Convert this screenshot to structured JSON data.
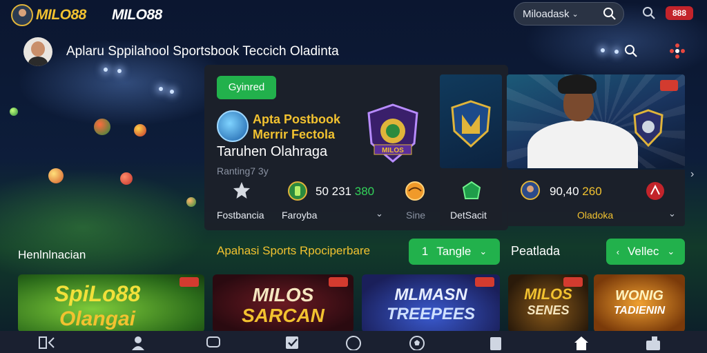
{
  "brand": {
    "logo_text": "MILO88",
    "logo_text_alt": "MILO88"
  },
  "top": {
    "user_label": "Miloadask",
    "badge_text": "888"
  },
  "header": {
    "headline": "Aplaru Sppilahool Sportsbook Teccich Oladinta"
  },
  "promo": {
    "badge": "Gyinred",
    "title_line1": "Apta Postbook",
    "title_line2": "Merrir Fectola",
    "subtitle": "Taruhen Olahraga",
    "ranking": "Ranting7 3y",
    "shield_text": "MILOS"
  },
  "stats": [
    {
      "label": "Fostbancia"
    },
    {
      "label": "Faroyba",
      "score_white": "50 231",
      "score_green": "380"
    },
    {
      "label": "Sine"
    },
    {
      "label": "DetSacit"
    },
    {
      "label": "Oladoka",
      "score_white": "90,40",
      "score_green": "260"
    }
  ],
  "left": {
    "label": "Henlnlnacian"
  },
  "section": {
    "title": "Apahasi Sports Rpociperbare",
    "btn1_num": "1",
    "btn1_label": "Tangle",
    "mid_label": "Peatlada",
    "btn2_label": "Vellec"
  },
  "tiles": [
    {
      "line1": "SpiLo88",
      "line2": "Olangai"
    },
    {
      "line1": "MILOS",
      "line2": "SARCAN"
    },
    {
      "line1": "MLMASN",
      "line2": "TREEPEES"
    },
    {
      "line1": "MILOS",
      "line2": "SENES"
    },
    {
      "line1": "WONIG",
      "line2": "TADIENIN"
    }
  ],
  "nav_icons": [
    "grid-back-icon",
    "user-icon",
    "chat-icon",
    "checklist-icon",
    "circle-icon",
    "football-icon",
    "clipboard-icon",
    "home-icon",
    "gift-icon"
  ],
  "colors": {
    "accent_gold": "#f2c230",
    "accent_green": "#22b14c",
    "accent_red": "#c3242b",
    "panel": "#1c202a"
  }
}
